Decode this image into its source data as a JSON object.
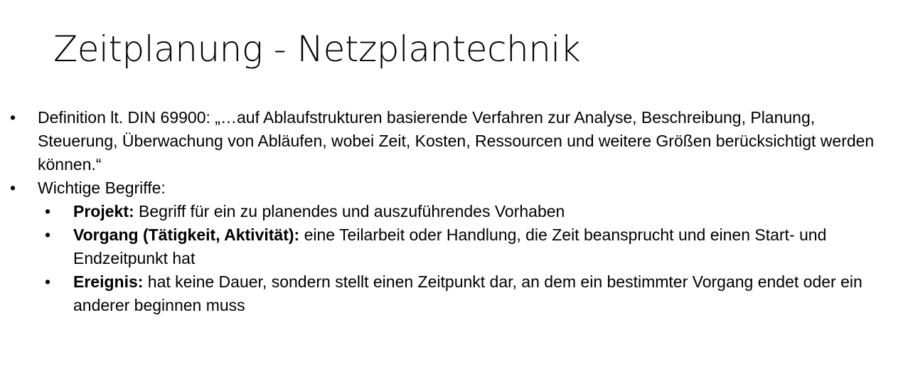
{
  "slide": {
    "title": "Zeitplanung - Netzplantechnik",
    "bullets": [
      {
        "text": "Definition lt. DIN 69900: „…auf Ablaufstrukturen basierende Verfahren zur Analyse, Beschreibung, Planung, Steuerung, Überwachung von Abläufen, wobei Zeit, Kosten, Ressourcen und weitere Größen berücksichtigt werden können.“"
      },
      {
        "text": "Wichtige Begriffe:",
        "sub_bullets": [
          {
            "term": "Projekt:",
            "text": " Begriff für ein zu planendes und auszuführendes Vorhaben"
          },
          {
            "term": "Vorgang (Tätigkeit, Aktivität):",
            "text": " eine Teilarbeit oder Handlung, die Zeit beansprucht und einen Start- und Endzeitpunkt hat"
          },
          {
            "term": "Ereignis:",
            "text": " hat keine Dauer, sondern stellt einen Zeitpunkt dar, an dem ein bestimmter Vorgang endet oder ein anderer beginnen muss"
          }
        ]
      }
    ],
    "bullet_glyph": "•"
  }
}
